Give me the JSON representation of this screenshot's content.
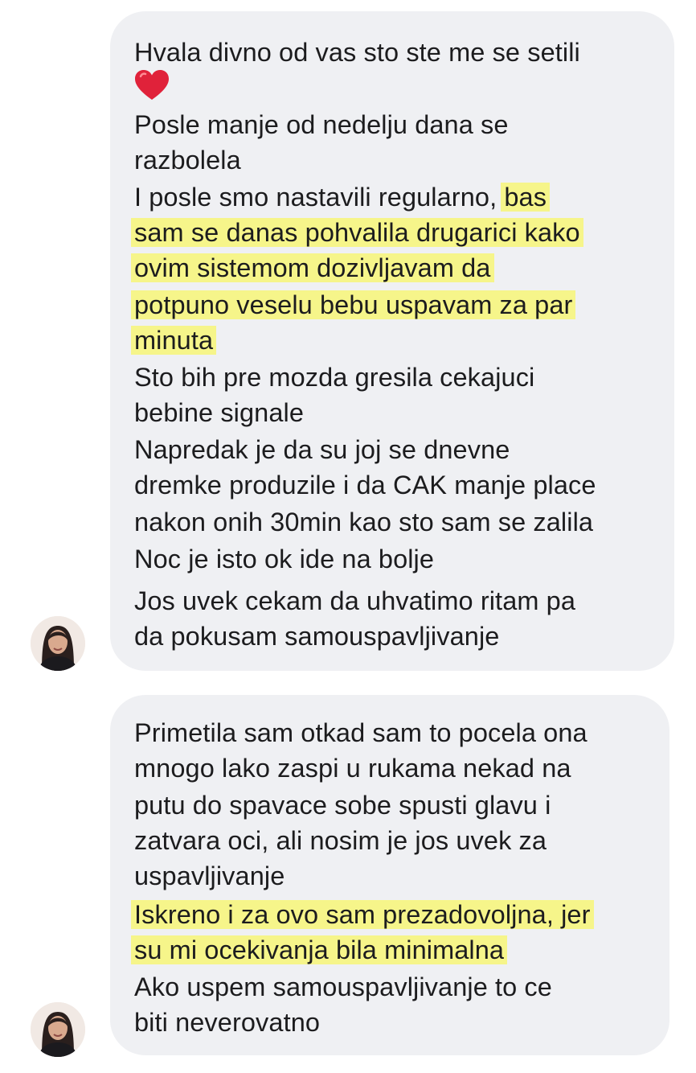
{
  "messages": [
    {
      "lines": [
        [
          "Hvala divno od vas sto ste me se setili"
        ],
        [
          "Posle manje od nedelju dana se"
        ],
        [
          "razbolela"
        ],
        [
          "I posle smo nastavili regularno, ",
          "bas"
        ],
        [
          "sam se danas pohvalila drugarici kako"
        ],
        [
          "ovim sistemom dozivljavam da"
        ],
        [
          "potpuno veselu bebu uspavam za par"
        ],
        [
          "minuta"
        ],
        [
          "Sto bih pre mozda gresila cekajuci"
        ],
        [
          "bebine signale"
        ],
        [
          "Napredak je da su joj se dnevne"
        ],
        [
          "dremke produzile i da CAK manje place"
        ],
        [
          "nakon onih 30min kao sto sam se zalila"
        ],
        [
          "Noc je isto ok ide na bolje"
        ],
        [
          "Jos uvek cekam da uhvatimo ritam pa"
        ],
        [
          "da pokusam samouspavljivanje"
        ]
      ],
      "emoji": "heart-emoji"
    },
    {
      "lines": [
        [
          "Primetila sam otkad sam to pocela ona"
        ],
        [
          "mnogo lako zaspi u rukama nekad na"
        ],
        [
          "putu do spavace sobe spusti glavu i"
        ],
        [
          "zatvara oci, ali nosim je jos uvek za"
        ],
        [
          "uspavljivanje"
        ],
        [
          "Iskreno i za ovo sam prezadovoljna, jer"
        ],
        [
          "su mi ocekivanja bila minimalna"
        ],
        [
          "Ako uspem samouspavljivanje to ce"
        ],
        [
          "biti neverovatno"
        ]
      ]
    }
  ],
  "colors": {
    "bubble_background": "#eff0f3",
    "highlight": "#f6f58a",
    "text": "#1c1c1e",
    "heart": "#e0223a"
  }
}
